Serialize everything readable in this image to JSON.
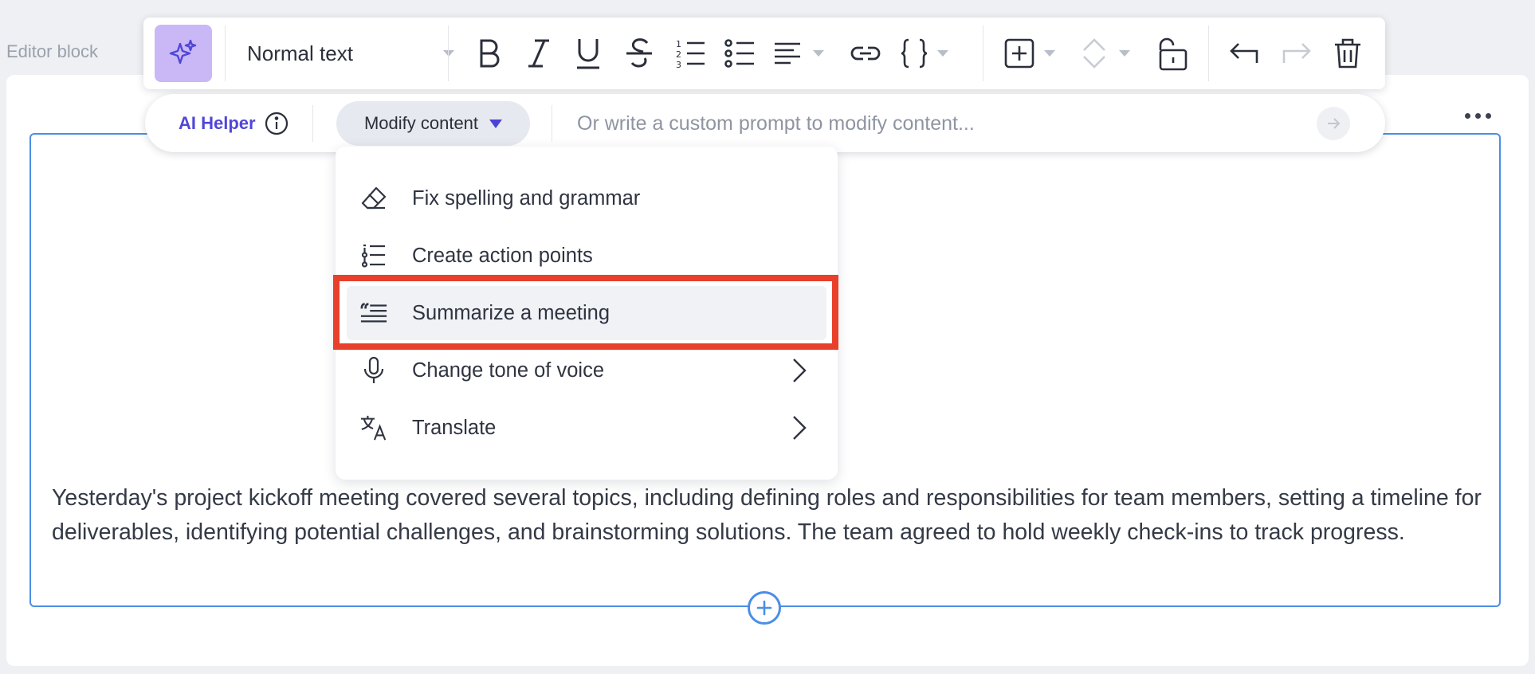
{
  "page": {
    "editor_label": "Editor block"
  },
  "toolbar": {
    "ai_button_icon": "sparkles-icon",
    "text_style": "Normal text",
    "buttons": [
      "bold-icon",
      "italic-icon",
      "underline-icon",
      "strikethrough-icon",
      "numbered-list-icon",
      "bulleted-list-icon",
      "align-icon",
      "link-icon",
      "code-braces-icon",
      "insert-icon",
      "move-icon",
      "unlock-icon",
      "undo-icon",
      "redo-icon",
      "trash-icon"
    ]
  },
  "ai_bar": {
    "label": "AI Helper",
    "modify_label": "Modify content",
    "prompt_placeholder": "Or write a custom prompt to modify content...",
    "prompt_value": ""
  },
  "menu": {
    "items": [
      {
        "label": "Fix spelling and grammar",
        "icon": "eraser-icon",
        "submenu": false,
        "active": false
      },
      {
        "label": "Create action points",
        "icon": "action-list-icon",
        "submenu": false,
        "active": false
      },
      {
        "label": "Summarize a meeting",
        "icon": "summary-quote-icon",
        "submenu": false,
        "active": true
      },
      {
        "label": "Change tone of voice",
        "icon": "microphone-icon",
        "submenu": true,
        "active": false
      },
      {
        "label": "Translate",
        "icon": "translate-icon",
        "submenu": true,
        "active": false
      }
    ]
  },
  "editor": {
    "content": "Yesterday's project kickoff meeting covered several topics, including defining roles and responsibilities for team members, setting a timeline for deliverables, identifying potential challenges, and brainstorming solutions. The team agreed to hold weekly check-ins to track progress."
  },
  "colors": {
    "accent": "#4a8ee6",
    "ai_purple": "#5046d8",
    "ai_button_bg": "#c9b8f5",
    "highlight": "#e8402b"
  }
}
